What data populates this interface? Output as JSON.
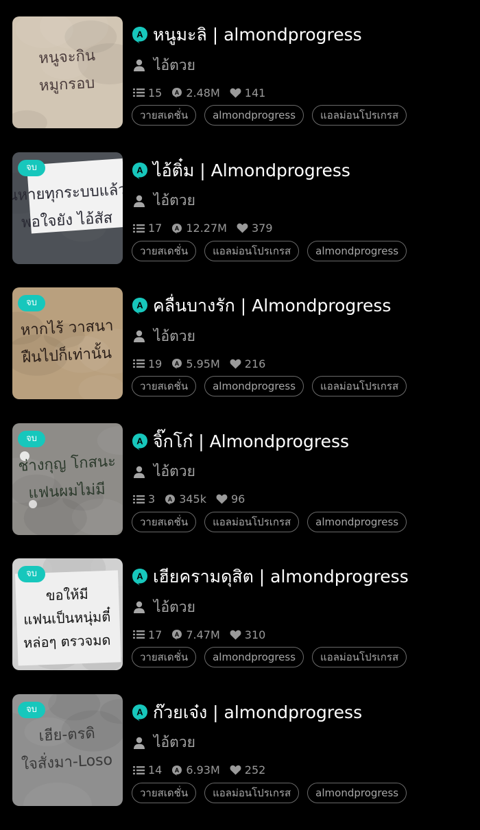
{
  "stories": [
    {
      "title": "หนูมะลิ | almondprogress",
      "author": "ไอ้ตวย",
      "completed": false,
      "badge": "",
      "chapters": "15",
      "views": "2.48M",
      "likes": "141",
      "tags": [
        "วายสเดชั่น",
        "almondprogress",
        "แอลม่อนโปรเกรส"
      ],
      "cover": {
        "bg": "#d2c6b4",
        "ink": "#4a3b3b",
        "lines": [
          "หนูจะกิน",
          "หมูกรอบ"
        ],
        "style": "wall"
      }
    },
    {
      "title": "ไอ้ติ๋ม | Almondprogress",
      "author": "ไอ้ตวย",
      "completed": true,
      "badge": "จบ",
      "chapters": "17",
      "views": "12.27M",
      "likes": "379",
      "tags": [
        "วายสเดชั่น",
        "แอลม่อนโปรเกรส",
        "almondprogress"
      ],
      "cover": {
        "bg": "#5c6066",
        "ink": "#2a2a34",
        "lines": [
          "นหายทุกระบบแล้ว",
          "พอใจยัง ไอ้สัส"
        ],
        "style": "paper"
      }
    },
    {
      "title": "คลื่นบางรัก | Almondprogress",
      "author": "ไอ้ตวย",
      "completed": true,
      "badge": "จบ",
      "chapters": "19",
      "views": "5.95M",
      "likes": "216",
      "tags": [
        "วายสเดชั่น",
        "almondprogress",
        "แอลม่อนโปรเกรส"
      ],
      "cover": {
        "bg": "#b9a07e",
        "ink": "#2a1e18",
        "lines": [
          "หากไร้ วาสนา",
          "ฝืนไปก็เท่านั้น"
        ],
        "style": "wall"
      }
    },
    {
      "title": "จิ๊กโก๋ | Almondprogress",
      "author": "ไอ้ตวย",
      "completed": true,
      "badge": "จบ",
      "chapters": "3",
      "views": "345k",
      "likes": "96",
      "tags": [
        "วายสเดชั่น",
        "แอลม่อนโปรเกรส",
        "almondprogress"
      ],
      "cover": {
        "bg": "#8e8c88",
        "ink": "#2c3a2c",
        "lines": [
          "ช่างกุญ โกสนะ",
          "แฟนผมไม่มี"
        ],
        "style": "concrete"
      }
    },
    {
      "title": "เฮียครามดุสิต | almondprogress",
      "author": "ไอ้ตวย",
      "completed": true,
      "badge": "จบ",
      "chapters": "17",
      "views": "7.47M",
      "likes": "310",
      "tags": [
        "วายสเดชั่น",
        "almondprogress",
        "แอลม่อนโปรเกรส"
      ],
      "cover": {
        "bg": "#cfcfcf",
        "ink": "#111111",
        "lines": [
          "ขอให้มี",
          "แฟนเป็นหนุ่มตี๋",
          "หล่อๆ ตรวจมด"
        ],
        "style": "sign"
      }
    },
    {
      "title": "ก๊วยเจ๋ง | almondprogress",
      "author": "ไอ้ตวย",
      "completed": true,
      "badge": "จบ",
      "chapters": "14",
      "views": "6.93M",
      "likes": "252",
      "tags": [
        "วายสเดชั่น",
        "แอลม่อนโปรเกรส",
        "almondprogress"
      ],
      "cover": {
        "bg": "#8f8f8f",
        "ink": "#3a3a3a",
        "lines": [
          "เฮีย-ตรดิ",
          "ใจสั่งมา-Loso"
        ],
        "style": "wall"
      }
    }
  ],
  "colors": {
    "background": "#000000",
    "accent": "#17c7bc",
    "muted_text": "#a6a6a6",
    "tag_border": "#6a6a6a"
  },
  "icons": {
    "title": "platform-logo-icon",
    "author": "person-icon",
    "chapters": "list-icon",
    "views": "views-icon",
    "likes": "heart-icon"
  }
}
